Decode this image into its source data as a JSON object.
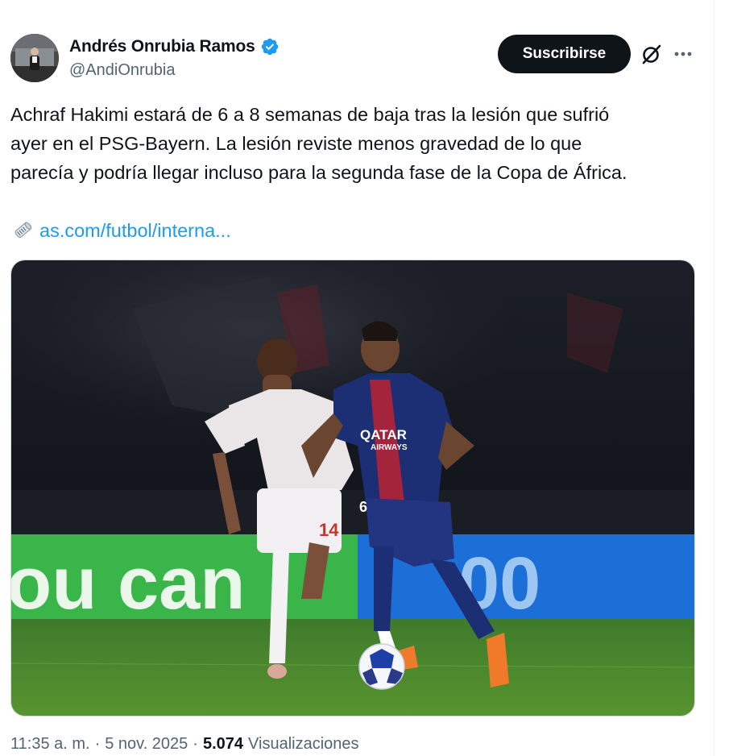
{
  "author": {
    "display_name": "Andrés Onrubia Ramos",
    "handle": "@AndiOnrubia",
    "verified": true,
    "verified_color": "#1d9bf0"
  },
  "actions": {
    "subscribe_label": "Suscribirse",
    "grok_icon": "grok-icon",
    "more_icon": "more-horizontal-icon"
  },
  "tweet": {
    "text_lines": [
      "Achraf Hakimi estará de 6 a 8 semanas de baja tras la lesión que sufrió",
      "ayer en el PSG-Bayern. La lesión reviste menos gravedad de lo que",
      "parecía y podría llegar incluso para la segunda fase de la Copa de África."
    ],
    "link_icon": "rolled-newspaper-icon",
    "link_text": "as.com/futbol/interna..."
  },
  "media": {
    "description_icon": "football-match-photo",
    "board_text": "ou can",
    "board_text_right": "00",
    "player_left_number": "14",
    "player_right_number": "6",
    "sponsor_line1": "QATAR",
    "sponsor_line2": "AIRWAYS"
  },
  "meta": {
    "time": "11:35 a. m.",
    "separator": "·",
    "date": "5 nov. 2025",
    "views_count": "5.074",
    "views_label": "Visualizaciones"
  },
  "colors": {
    "text_primary": "#0f1419",
    "text_secondary": "#536471",
    "link": "#1d9bf0",
    "button_bg": "#0f1419"
  }
}
